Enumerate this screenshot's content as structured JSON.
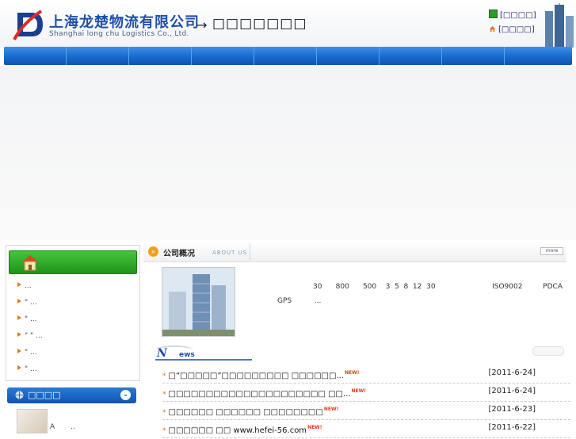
{
  "header": {
    "company_cn": "上海龙楚物流有限公司",
    "company_en": "Shanghai  long chu   Logistics    Co., Ltd.",
    "arrow": "→",
    "slogan": "□□□□□□□",
    "links": [
      {
        "label": "[□□□□]",
        "icon": "favorite-icon"
      },
      {
        "label": "[□□□□]",
        "icon": "home-icon"
      }
    ]
  },
  "nav": {
    "items": [
      "",
      "",
      "",
      "",
      "",
      "",
      "",
      "",
      ""
    ]
  },
  "left_menu": {
    "items": [
      "...",
      "\"  ...",
      "\"  ...",
      "\"  \"   ...",
      "\"  ...",
      "\"  ..."
    ]
  },
  "left_box2": {
    "title": "□□□□",
    "thumb_text": "A       .."
  },
  "about": {
    "title": "公司概况",
    "subtitle": "ABOUT US",
    "more": "more",
    "line1": "30      800      500    3  5  8  12  30                         ISO9002         PDCA",
    "line2": "GPS          ..."
  },
  "news": {
    "heading_letter": "N",
    "heading_rest": "ews",
    "new_badge": "NEW!",
    "items": [
      {
        "title": "□“□□□□□”□□□□□□□□□ □□□□□□...",
        "date": "[2011-6-24]"
      },
      {
        "title": "□□□□□□□□□□□□□□□□□□□□□  □□...",
        "date": "[2011-6-24]"
      },
      {
        "title": "□□□□□□ □□□□□□ □□□□□□□□",
        "date": "[2011-6-23]"
      },
      {
        "title": "□□□□□□ □□ www.hefei-56.com",
        "date": "[2011-6-22]"
      }
    ]
  }
}
